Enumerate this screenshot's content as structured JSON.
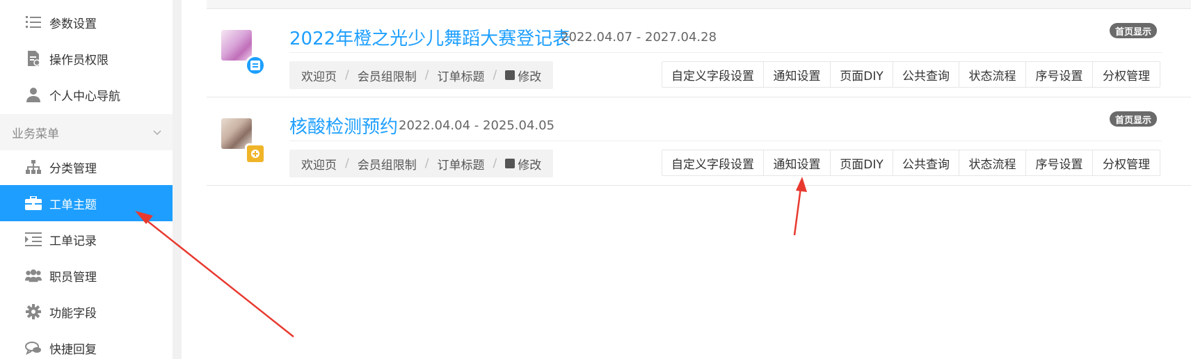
{
  "sidebar": {
    "items_top": [
      {
        "label": "参数设置",
        "icon": "list-settings-icon"
      },
      {
        "label": "操作员权限",
        "icon": "file-permission-icon"
      },
      {
        "label": "个人中心导航",
        "icon": "user-icon"
      }
    ],
    "group_label": "业务菜单",
    "items_business": [
      {
        "label": "分类管理",
        "icon": "hierarchy-icon"
      },
      {
        "label": "工单主题",
        "icon": "briefcase-icon",
        "active": true
      },
      {
        "label": "工单记录",
        "icon": "indent-list-icon"
      },
      {
        "label": "职员管理",
        "icon": "users-icon"
      },
      {
        "label": "功能字段",
        "icon": "gear-icon"
      },
      {
        "label": "快捷回复",
        "icon": "chat-icon"
      }
    ]
  },
  "records": [
    {
      "title": "2022年橙之光少儿舞蹈大赛登记表",
      "date_range": "2022.04.07 - 2027.04.28",
      "tag": "首页显示",
      "breadcrumb": [
        "欢迎页",
        "会员组限制",
        "订单标题"
      ],
      "edit_label": "修改",
      "actions": [
        "自定义字段设置",
        "通知设置",
        "页面DIY",
        "公共查询",
        "状态流程",
        "序号设置",
        "分权管理"
      ]
    },
    {
      "title": "核酸检测预约",
      "date_range": "2022.04.04 - 2025.04.05",
      "tag": "首页显示",
      "breadcrumb": [
        "欢迎页",
        "会员组限制",
        "订单标题"
      ],
      "edit_label": "修改",
      "actions": [
        "自定义字段设置",
        "通知设置",
        "页面DIY",
        "公共查询",
        "状态流程",
        "序号设置",
        "分权管理"
      ]
    }
  ],
  "colors": {
    "accent": "#1E9FFF",
    "annotation_arrow": "#E8392F",
    "tag_bg": "#6a6a6a"
  }
}
